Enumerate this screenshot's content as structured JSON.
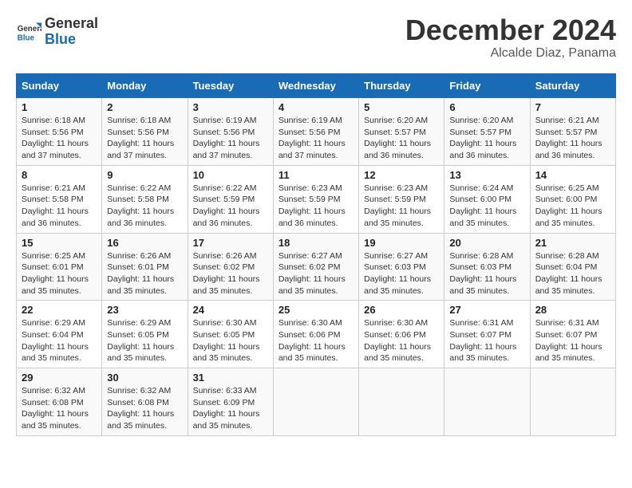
{
  "logo": {
    "line1": "General",
    "line2": "Blue"
  },
  "title": "December 2024",
  "location": "Alcalde Diaz, Panama",
  "days_of_week": [
    "Sunday",
    "Monday",
    "Tuesday",
    "Wednesday",
    "Thursday",
    "Friday",
    "Saturday"
  ],
  "weeks": [
    [
      {
        "day": 1,
        "info": "Sunrise: 6:18 AM\nSunset: 5:56 PM\nDaylight: 11 hours\nand 37 minutes."
      },
      {
        "day": 2,
        "info": "Sunrise: 6:18 AM\nSunset: 5:56 PM\nDaylight: 11 hours\nand 37 minutes."
      },
      {
        "day": 3,
        "info": "Sunrise: 6:19 AM\nSunset: 5:56 PM\nDaylight: 11 hours\nand 37 minutes."
      },
      {
        "day": 4,
        "info": "Sunrise: 6:19 AM\nSunset: 5:56 PM\nDaylight: 11 hours\nand 37 minutes."
      },
      {
        "day": 5,
        "info": "Sunrise: 6:20 AM\nSunset: 5:57 PM\nDaylight: 11 hours\nand 36 minutes."
      },
      {
        "day": 6,
        "info": "Sunrise: 6:20 AM\nSunset: 5:57 PM\nDaylight: 11 hours\nand 36 minutes."
      },
      {
        "day": 7,
        "info": "Sunrise: 6:21 AM\nSunset: 5:57 PM\nDaylight: 11 hours\nand 36 minutes."
      }
    ],
    [
      {
        "day": 8,
        "info": "Sunrise: 6:21 AM\nSunset: 5:58 PM\nDaylight: 11 hours\nand 36 minutes."
      },
      {
        "day": 9,
        "info": "Sunrise: 6:22 AM\nSunset: 5:58 PM\nDaylight: 11 hours\nand 36 minutes."
      },
      {
        "day": 10,
        "info": "Sunrise: 6:22 AM\nSunset: 5:59 PM\nDaylight: 11 hours\nand 36 minutes."
      },
      {
        "day": 11,
        "info": "Sunrise: 6:23 AM\nSunset: 5:59 PM\nDaylight: 11 hours\nand 36 minutes."
      },
      {
        "day": 12,
        "info": "Sunrise: 6:23 AM\nSunset: 5:59 PM\nDaylight: 11 hours\nand 35 minutes."
      },
      {
        "day": 13,
        "info": "Sunrise: 6:24 AM\nSunset: 6:00 PM\nDaylight: 11 hours\nand 35 minutes."
      },
      {
        "day": 14,
        "info": "Sunrise: 6:25 AM\nSunset: 6:00 PM\nDaylight: 11 hours\nand 35 minutes."
      }
    ],
    [
      {
        "day": 15,
        "info": "Sunrise: 6:25 AM\nSunset: 6:01 PM\nDaylight: 11 hours\nand 35 minutes."
      },
      {
        "day": 16,
        "info": "Sunrise: 6:26 AM\nSunset: 6:01 PM\nDaylight: 11 hours\nand 35 minutes."
      },
      {
        "day": 17,
        "info": "Sunrise: 6:26 AM\nSunset: 6:02 PM\nDaylight: 11 hours\nand 35 minutes."
      },
      {
        "day": 18,
        "info": "Sunrise: 6:27 AM\nSunset: 6:02 PM\nDaylight: 11 hours\nand 35 minutes."
      },
      {
        "day": 19,
        "info": "Sunrise: 6:27 AM\nSunset: 6:03 PM\nDaylight: 11 hours\nand 35 minutes."
      },
      {
        "day": 20,
        "info": "Sunrise: 6:28 AM\nSunset: 6:03 PM\nDaylight: 11 hours\nand 35 minutes."
      },
      {
        "day": 21,
        "info": "Sunrise: 6:28 AM\nSunset: 6:04 PM\nDaylight: 11 hours\nand 35 minutes."
      }
    ],
    [
      {
        "day": 22,
        "info": "Sunrise: 6:29 AM\nSunset: 6:04 PM\nDaylight: 11 hours\nand 35 minutes."
      },
      {
        "day": 23,
        "info": "Sunrise: 6:29 AM\nSunset: 6:05 PM\nDaylight: 11 hours\nand 35 minutes."
      },
      {
        "day": 24,
        "info": "Sunrise: 6:30 AM\nSunset: 6:05 PM\nDaylight: 11 hours\nand 35 minutes."
      },
      {
        "day": 25,
        "info": "Sunrise: 6:30 AM\nSunset: 6:06 PM\nDaylight: 11 hours\nand 35 minutes."
      },
      {
        "day": 26,
        "info": "Sunrise: 6:30 AM\nSunset: 6:06 PM\nDaylight: 11 hours\nand 35 minutes."
      },
      {
        "day": 27,
        "info": "Sunrise: 6:31 AM\nSunset: 6:07 PM\nDaylight: 11 hours\nand 35 minutes."
      },
      {
        "day": 28,
        "info": "Sunrise: 6:31 AM\nSunset: 6:07 PM\nDaylight: 11 hours\nand 35 minutes."
      }
    ],
    [
      {
        "day": 29,
        "info": "Sunrise: 6:32 AM\nSunset: 6:08 PM\nDaylight: 11 hours\nand 35 minutes."
      },
      {
        "day": 30,
        "info": "Sunrise: 6:32 AM\nSunset: 6:08 PM\nDaylight: 11 hours\nand 35 minutes."
      },
      {
        "day": 31,
        "info": "Sunrise: 6:33 AM\nSunset: 6:09 PM\nDaylight: 11 hours\nand 35 minutes."
      },
      null,
      null,
      null,
      null
    ]
  ]
}
